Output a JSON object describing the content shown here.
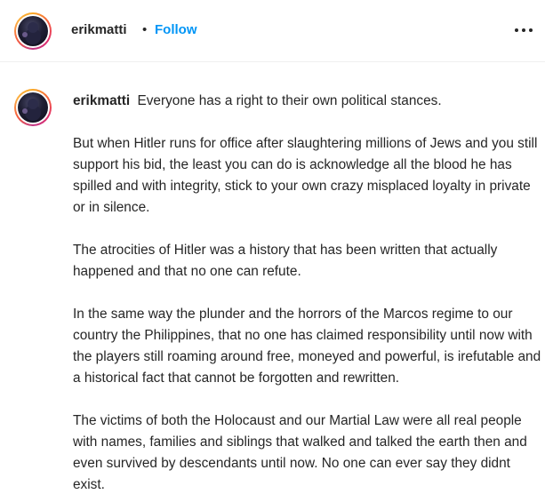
{
  "header": {
    "username": "erikmatti",
    "separator": "•",
    "follow_label": "Follow",
    "more_icon": "more-horizontal-icon"
  },
  "comment": {
    "username": "erikmatti",
    "paragraphs": [
      "Everyone has a right to their own political stances.",
      "But when Hitler runs for office after slaughtering millions of Jews and you still support his bid, the least you can do is acknowledge all the blood he has spilled and with integrity, stick to your own crazy misplaced loyalty in private or in silence.",
      "The atrocities of Hitler was a history that has been written that actually happened and that no one can refute.",
      "In the same way the plunder and the horrors of the Marcos regime to our country the Philippines, that no one has claimed responsibility until now with the players still roaming around free, moneyed and powerful, is irefutable and a historical fact that cannot be forgotten and rewritten.",
      "The victims of both the Holocaust and our Martial Law were all real people with names, families and siblings that walked and talked the earth then and even survived by descendants until now. No one can ever say they didnt exist."
    ]
  },
  "colors": {
    "follow": "#0095f6",
    "text": "#262626",
    "divider": "#efefef"
  }
}
